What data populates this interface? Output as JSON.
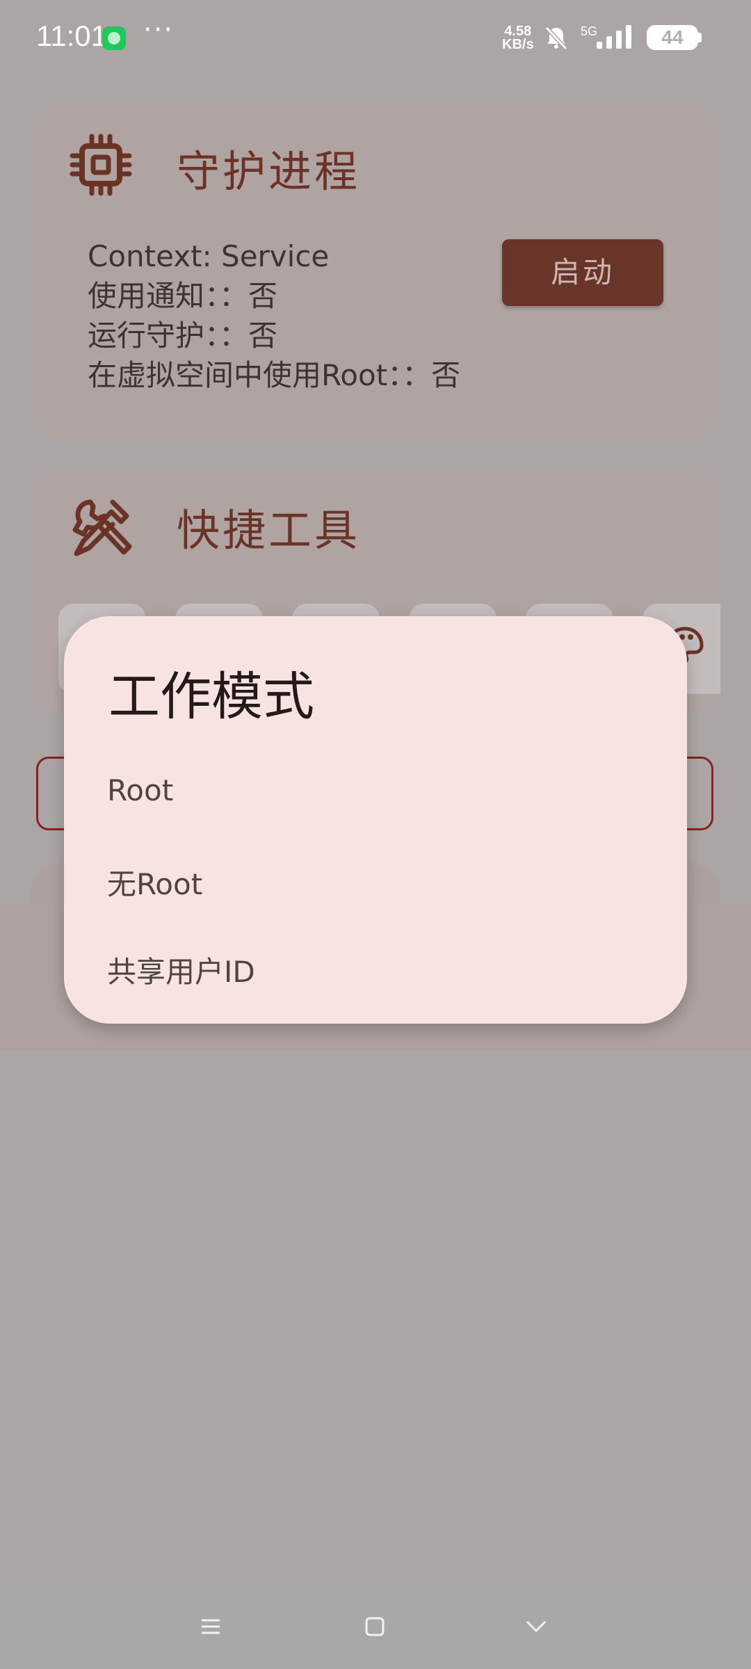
{
  "status_bar": {
    "time": "11:01",
    "more": "···",
    "speed_value": "4.58",
    "speed_unit": "KB/s",
    "network": "5G",
    "battery": "44"
  },
  "daemon_card": {
    "icon": "cpu-chip-icon",
    "title": "守护进程",
    "lines": [
      "Context: Service",
      "使用通知：：否",
      "运行守护：：否",
      "在虚拟空间中使用Root：：否"
    ],
    "start_button": "启动"
  },
  "tools_card": {
    "icon": "tools-icon",
    "title": "快捷工具"
  },
  "dialog": {
    "title": "工作模式",
    "options": [
      "Root",
      "无Root",
      "共享用户ID"
    ]
  },
  "colors": {
    "accent": "#683528",
    "dialog_bg": "#f7e3e1",
    "outline": "#8a2020"
  },
  "nav_bar": {
    "icons": [
      "menu-icon",
      "home-icon",
      "back-icon"
    ]
  }
}
